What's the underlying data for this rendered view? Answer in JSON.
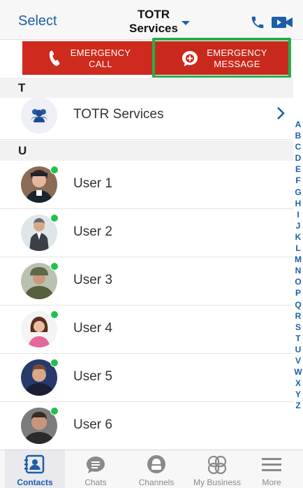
{
  "header": {
    "select_label": "Select",
    "title_line1": "TOTR",
    "title_line2": "Services"
  },
  "emergency": {
    "call_line1": "EMERGENCY",
    "call_line2": "CALL",
    "message_line1": "EMERGENCY",
    "message_line2": "MESSAGE"
  },
  "sections": [
    {
      "letter": "T"
    },
    {
      "letter": "U"
    }
  ],
  "group": {
    "name": "TOTR Services"
  },
  "users": [
    {
      "name": "User 1"
    },
    {
      "name": "User 2"
    },
    {
      "name": "User 3"
    },
    {
      "name": "User 4"
    },
    {
      "name": "User 5"
    },
    {
      "name": "User 6"
    }
  ],
  "index_letters": [
    "A",
    "B",
    "C",
    "D",
    "E",
    "F",
    "G",
    "H",
    "I",
    "J",
    "K",
    "L",
    "M",
    "N",
    "O",
    "P",
    "Q",
    "R",
    "S",
    "T",
    "U",
    "V",
    "W",
    "X",
    "Y",
    "Z"
  ],
  "tabs": [
    {
      "label": "Contacts",
      "icon": "contacts-icon"
    },
    {
      "label": "Chats",
      "icon": "chats-icon"
    },
    {
      "label": "Channels",
      "icon": "channels-icon"
    },
    {
      "label": "My Business",
      "icon": "my-business-icon"
    },
    {
      "label": "More",
      "icon": "more-icon"
    }
  ],
  "colors": {
    "accent": "#1c5fa8",
    "emergency_red": "#cf2a1e",
    "highlight_green": "#20b14b",
    "online_green": "#22c04b"
  }
}
